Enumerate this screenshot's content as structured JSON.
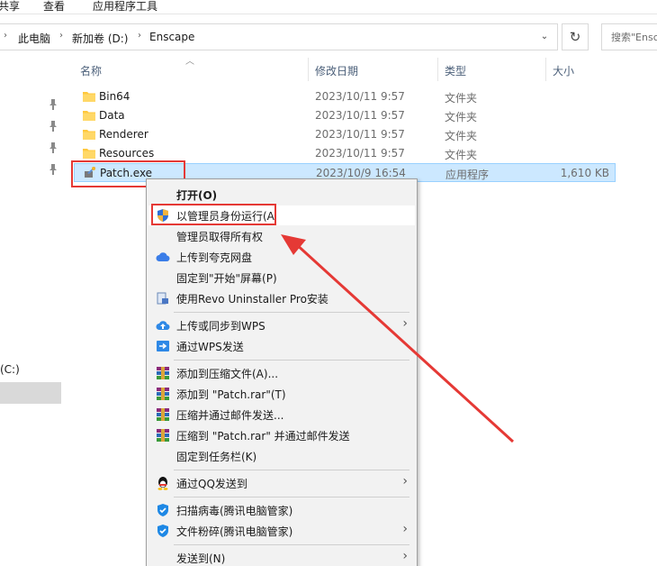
{
  "ribbon": {
    "tab_share": "共享",
    "tab_view": "查看",
    "tab_app_tools": "应用程序工具"
  },
  "address": {
    "crumbs": [
      "此电脑",
      "新加卷 (D:)",
      "Enscape"
    ],
    "dropdown": "⌄",
    "refresh": "↻",
    "search_placeholder": "搜索\"Enscape\""
  },
  "nav": {
    "drive_label": "(C:)"
  },
  "columns": {
    "name": "名称",
    "modified": "修改日期",
    "type": "类型",
    "size": "大小"
  },
  "files": [
    {
      "name": "Bin64",
      "date": "2023/10/11 9:57",
      "type": "文件夹",
      "size": ""
    },
    {
      "name": "Data",
      "date": "2023/10/11 9:57",
      "type": "文件夹",
      "size": ""
    },
    {
      "name": "Renderer",
      "date": "2023/10/11 9:57",
      "type": "文件夹",
      "size": ""
    },
    {
      "name": "Resources",
      "date": "2023/10/11 9:57",
      "type": "文件夹",
      "size": ""
    },
    {
      "name": "Patch.exe",
      "date": "2023/10/9 16:54",
      "type": "应用程序",
      "size": "1,610 KB"
    }
  ],
  "menu": {
    "open": "打开(O)",
    "run_as_admin": "以管理员身份运行(A",
    "take_ownership": "管理员取得所有权",
    "upload_quark": "上传到夸克网盘",
    "pin_start": "固定到\"开始\"屏幕(P)",
    "revo": "使用Revo Uninstaller Pro安装",
    "upload_wps": "上传或同步到WPS",
    "send_wps": "通过WPS发送",
    "add_archive": "添加到压缩文件(A)...",
    "add_patch_rar": "添加到 \"Patch.rar\"(T)",
    "compress_email": "压缩并通过邮件发送...",
    "compress_patch_email": "压缩到 \"Patch.rar\" 并通过邮件发送",
    "pin_taskbar": "固定到任务栏(K)",
    "send_qq": "通过QQ发送到",
    "scan_virus": "扫描病毒(腾讯电脑管家)",
    "shred": "文件粉碎(腾讯电脑管家)",
    "send_to": "发送到(N)"
  },
  "colors": {
    "selection_bg": "#cce8ff",
    "highlight_red": "#e53935",
    "folder_yellow": "#ffc83d"
  }
}
